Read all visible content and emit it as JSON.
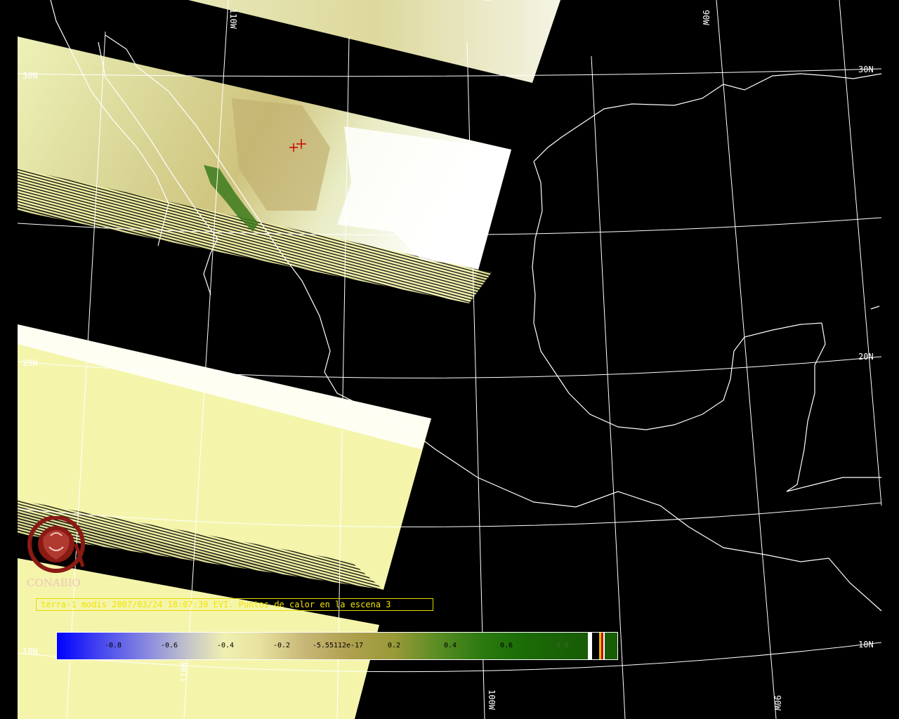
{
  "map": {
    "parallel_labels": [
      "30N",
      "30N",
      "20N",
      "20N",
      "10N",
      "10N"
    ],
    "meridian_labels": [
      "110W",
      "90W",
      "110W",
      "100W",
      "90W"
    ],
    "hotspot_markers": 2
  },
  "logo": {
    "name": "CONABIO"
  },
  "caption": {
    "text": "terra-1 modis 2007/03/24 18:07:39 EVI. Puntos de calor en la escena 3"
  },
  "colorbar": {
    "ticks": [
      "-0.8",
      "-0.6",
      "-0.4",
      "-0.2",
      "-5.55112e-17",
      "0.2",
      "0.4",
      "0.6",
      "0.8"
    ],
    "colors": {
      "low": "#0000ff",
      "mid": "#f0f0b0",
      "high": "#185c06"
    }
  },
  "colors": {
    "background": "#000000",
    "swath": "#f2f2a6",
    "cloud": "#ffffff",
    "grid": "#ffffff",
    "caption_border": "#e6d800",
    "caption_text": "#f2e400",
    "logo": "#8a1a14",
    "hotspot": "#cc0000"
  }
}
